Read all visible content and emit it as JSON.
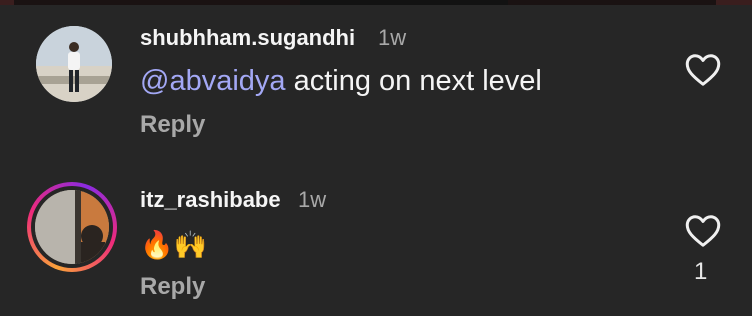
{
  "comments": [
    {
      "username": "shubhham.sugandhi",
      "time": "1w",
      "mention": "@abvaidya",
      "text": " acting on next level",
      "reply_label": "Reply",
      "like_icon": "heart-outline-icon"
    },
    {
      "username": "itz_rashibabe",
      "time": "1w",
      "emojis": "🔥🙌",
      "reply_label": "Reply",
      "like_icon": "heart-outline-icon",
      "like_count": "1",
      "has_story_ring": true
    }
  ],
  "colors": {
    "background": "#262626",
    "mention": "#a3a8f5",
    "secondary_text": "#a8a8a8"
  }
}
